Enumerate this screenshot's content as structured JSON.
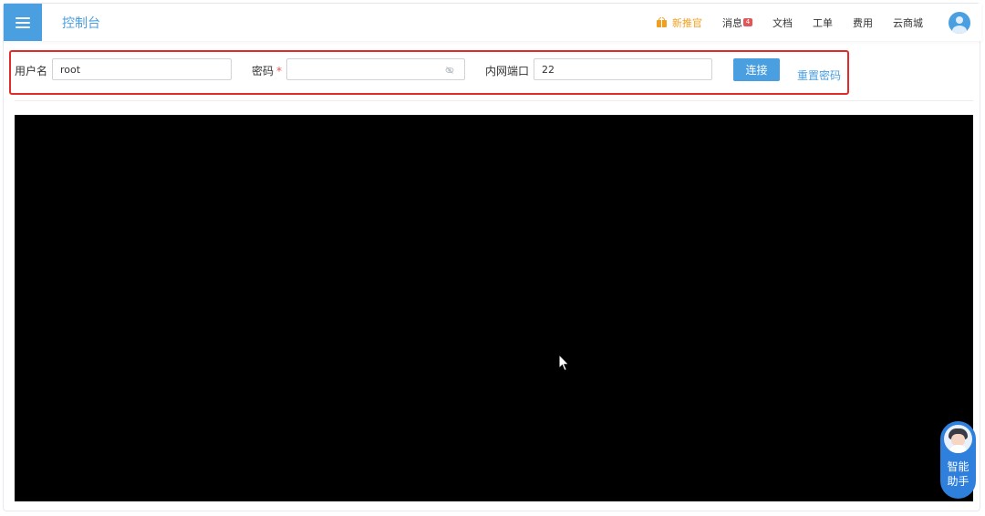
{
  "header": {
    "title": "控制台",
    "nav": {
      "promo": "新推官",
      "messages": "消息",
      "messages_badge": "4",
      "docs": "文档",
      "tickets": "工单",
      "billing": "费用",
      "store": "云商城"
    }
  },
  "form": {
    "username_label": "用户名",
    "username_value": "root",
    "password_label": "密码",
    "password_required": "*",
    "password_value": "",
    "port_label": "内网端口",
    "port_value": "22",
    "connect_label": "连接",
    "reset_label": "重置密码"
  },
  "assistant": {
    "line1": "智能",
    "line2": "助手"
  },
  "colors": {
    "accent": "#4a9fe0",
    "highlight_border": "#e32b2b",
    "promo": "#f0a020",
    "terminal_bg": "#000000"
  },
  "icons": [
    "menu-icon",
    "gift-icon",
    "avatar-icon",
    "eye-off-icon",
    "mouse-cursor-icon",
    "assistant-avatar-icon"
  ]
}
